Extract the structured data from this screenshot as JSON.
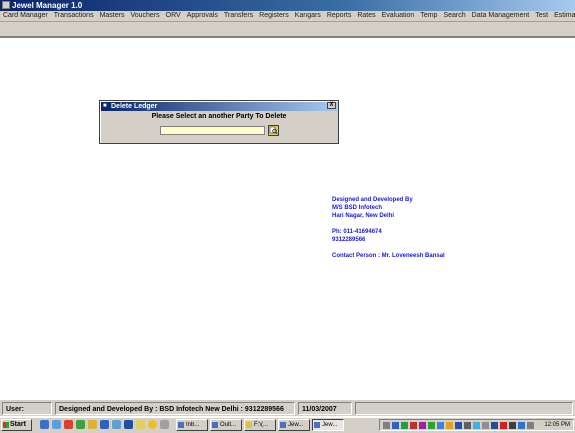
{
  "window": {
    "title": "Jewel Manager 1.0"
  },
  "menu": [
    "Card Manager",
    "Transactions",
    "Masters",
    "Vouchers",
    "ORV",
    "Approvals",
    "Transfers",
    "Registers",
    "Kangars",
    "Reports",
    "Rates",
    "Evaluation",
    "Temp",
    "Search",
    "Data Management",
    "Test",
    "Estimate Calculator"
  ],
  "dialog": {
    "title": "Delete Ledger",
    "close_label": "X",
    "prompt": "Please Select an another Party To Delete",
    "input_value": "",
    "button_icon": "search-icon"
  },
  "credits": {
    "line1": "Designed and Developed By",
    "line2": "M/S BSD Infotech",
    "line3": "Hari Nagar, New Delhi",
    "phone1": "Ph: 011-41694674",
    "phone2": "9312289566",
    "contact": "Contact Person : Mr. Loveneesh Bansal"
  },
  "statusbar": {
    "user_label": "User:",
    "developer": "Designed and Developed By : BSD Infotech New Delhi : 9312289566",
    "date": "11/03/2007"
  },
  "taskbar": {
    "start_label": "Start",
    "tasks": [
      "Inb...",
      "Outl...",
      "F:\\(...",
      "Jew...",
      "Jew..."
    ],
    "clock": "12:05 PM"
  },
  "colors": {
    "title_bar": "#0a246a",
    "chrome": "#d4d0c8",
    "credits_text": "#1a1ad8",
    "input_bg": "#ffffcc"
  }
}
